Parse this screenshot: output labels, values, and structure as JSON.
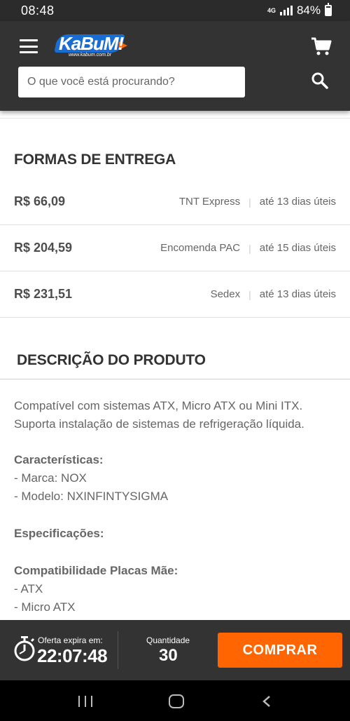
{
  "status_bar": {
    "time": "08:48",
    "network": "4G",
    "battery": "84%"
  },
  "header": {
    "logo_text": "KaBuM!",
    "logo_sub": "www.kabum.com.br",
    "search_placeholder": "O que você está procurando?",
    "colors": {
      "background": "#333333",
      "brand_blue": "#1a6dd3",
      "brand_orange": "#ff6500"
    }
  },
  "shipping": {
    "title": "FORMAS DE ENTREGA",
    "options": [
      {
        "price": "R$ 66,09",
        "method": "TNT Express",
        "days": "até 13 dias úteis"
      },
      {
        "price": "R$ 204,59",
        "method": "Encomenda PAC",
        "days": "até 15 dias úteis"
      },
      {
        "price": "R$ 231,51",
        "method": "Sedex",
        "days": "até 13 dias úteis"
      }
    ]
  },
  "description": {
    "title": "DESCRIÇÃO DO PRODUTO",
    "intro_line1": "Compatível com sistemas ATX, Micro ATX ou Mini ITX.",
    "intro_line2": "Suporta instalação de sistemas de refrigeração líquida.",
    "features_heading": "Características:",
    "features": [
      "- Marca: NOX",
      "- Modelo: NXINFINTYSIGMA"
    ],
    "specs_heading": "Especificações:",
    "compat_heading": "Compatibilidade Placas Mãe:",
    "compat": [
      "- ATX",
      "- Micro ATX"
    ]
  },
  "bottom_bar": {
    "offer_label": "Oferta expira em:",
    "offer_time": "22:07:48",
    "qty_label": "Quantidade",
    "qty_value": "30",
    "buy_label": "COMPRAR"
  },
  "icons": {
    "menu": "menu-icon",
    "cart": "cart-icon",
    "search": "search-icon",
    "timer": "timer-icon"
  }
}
